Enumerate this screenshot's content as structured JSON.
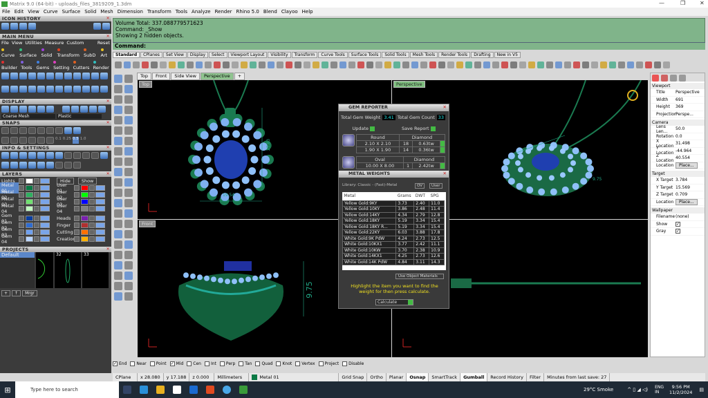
{
  "window": {
    "title": "Matrix 9.0 (64-bit) - uploads_files_3819209_1.3dm"
  },
  "menubar": [
    "File",
    "Edit",
    "View",
    "Curve",
    "Surface",
    "Solid",
    "Mesh",
    "Dimension",
    "Transform",
    "Tools",
    "Analyze",
    "Render",
    "Rhino 5.0",
    "Blend",
    "Clayoo",
    "Help"
  ],
  "left": {
    "icon_history": "ICON HISTORY",
    "main_menu": {
      "title": "MAIN MENU",
      "items": [
        "File",
        "View",
        "Utilities",
        "Measure",
        "Custom"
      ],
      "reset": "Reset",
      "row1": [
        {
          "l": "Curve",
          "c": "#e8c020"
        },
        {
          "l": "Surface",
          "c": "#30c080"
        },
        {
          "l": "Solid",
          "c": "#a040e0"
        },
        {
          "l": "Transform",
          "c": "#e04020"
        },
        {
          "l": "SubD",
          "c": "#e06020"
        },
        {
          "l": "Art",
          "c": "#e8c020"
        }
      ],
      "row2": [
        {
          "l": "Builder",
          "c": "#e03030"
        },
        {
          "l": "Tools",
          "c": "#8060e0"
        },
        {
          "l": "Gems",
          "c": "#4080e0"
        },
        {
          "l": "Setting",
          "c": "#e040c0"
        },
        {
          "l": "Cutters",
          "c": "#e06020"
        },
        {
          "l": "Render",
          "c": "#30c0c0"
        }
      ]
    },
    "display": {
      "title": "DISPLAY",
      "mesh": "Coarse Mesh",
      "material": "Plastic"
    },
    "snaps": {
      "title": "SNAPS",
      "values": [
        "0.1",
        "0.25",
        "0.5",
        "1.0"
      ]
    },
    "info": {
      "title": "INFO & SETTINGS"
    },
    "layers": {
      "title": "LAYERS",
      "lights": "Lights",
      "hide": "Hide",
      "show": "Show",
      "left": [
        {
          "n": "Metal 01",
          "c": "#0b7a45"
        },
        {
          "n": "Metal 02",
          "c": "#2fb060"
        },
        {
          "n": "Metal 03",
          "c": "#70e070"
        },
        {
          "n": "Metal 04",
          "c": "#c0f8c0"
        },
        {
          "n": "Gem 01",
          "c": "#0a3ea0"
        },
        {
          "n": "Gem 02",
          "c": "#2f6cd0"
        },
        {
          "n": "Gem 03",
          "c": "#6ea0f0"
        },
        {
          "n": "Gem 04",
          "c": "#b8d4ff"
        }
      ],
      "right": [
        {
          "n": "User 01",
          "c": "#ff0000"
        },
        {
          "n": "User 02",
          "c": "#00ff00"
        },
        {
          "n": "User 03",
          "c": "#0000ff"
        },
        {
          "n": "User 04",
          "c": "#808080"
        },
        {
          "n": "Heads",
          "c": "#7a20b0"
        },
        {
          "n": "Finger",
          "c": "#b03030"
        },
        {
          "n": "Cutting",
          "c": "#ff7000"
        },
        {
          "n": "Creation",
          "c": "#ffb000"
        }
      ]
    },
    "projects": {
      "title": "PROJECTS",
      "items": [
        "Default"
      ],
      "thumbs": [
        "32",
        "33"
      ],
      "merge": "Mrgr"
    }
  },
  "command": {
    "lines": [
      "Volume Total: 337.088779571623",
      "Command: _Show",
      "Showing 2 hidden objects."
    ],
    "prompt": "Command:"
  },
  "toolbar_tabs": [
    "Standard",
    "CPlanes",
    "Set View",
    "Display",
    "Select",
    "Viewport Layout",
    "Visibility",
    "Transform",
    "Curve Tools",
    "Surface Tools",
    "Solid Tools",
    "Mesh Tools",
    "Render Tools",
    "Drafting",
    "New in V5"
  ],
  "viewport_tabs": [
    "Top",
    "Front",
    "Side View",
    "Perspective",
    "+"
  ],
  "viewports": {
    "top": "Top",
    "front": "Front",
    "perspective": "Perspective",
    "dims": {
      "height": "27.83",
      "width": "19.54",
      "front_height": "9.75",
      "persp_a": "9.75",
      "persp_b": "19.54"
    }
  },
  "gem_reporter": {
    "title": "GEM REPORTER",
    "total_weight_label": "Total Gem Weight",
    "total_weight": "3.41",
    "total_count_label": "Total Gem Count",
    "total_count": "33",
    "update": "Update",
    "save": "Save Report",
    "groups": [
      {
        "shape": "Round",
        "material": "Diamond",
        "rows": [
          {
            "size": "2.10 X 2.10",
            "count": "18",
            "weight": "0.63tw"
          },
          {
            "size": "1.90 X 1.90",
            "count": "14",
            "weight": "0.36tw"
          }
        ]
      },
      {
        "shape": "Oval",
        "material": "Diamond",
        "rows": [
          {
            "size": "10.00 X 8.00",
            "count": "1",
            "weight": "2.42tw"
          }
        ]
      }
    ]
  },
  "metal_weights": {
    "title": "METAL WEIGHTS",
    "library": "Library: Classic - (Fast)-Metal",
    "ov": "OV",
    "user": "User",
    "columns": [
      "Metal",
      "Grams",
      "DWT",
      "SPG"
    ],
    "rows": [
      [
        "Yellow Gold:9KY",
        "3.73",
        "2.40",
        "11.0"
      ],
      [
        "Yellow Gold:10KY",
        "3.86",
        "2.48",
        "11.4"
      ],
      [
        "Yellow Gold:14KY",
        "4.34",
        "2.79",
        "12.8"
      ],
      [
        "Yellow Gold:18KY",
        "5.19",
        "3.34",
        "15.4"
      ],
      [
        "Yellow Gold:18KY R...",
        "5.19",
        "3.34",
        "15.4"
      ],
      [
        "Yellow Gold:22KY",
        "6.03",
        "3.88",
        "17.8"
      ],
      [
        "White Gold:9K PdW",
        "4.24",
        "2.73",
        "12.5"
      ],
      [
        "White Gold:10KX1",
        "3.77",
        "2.42",
        "11.1"
      ],
      [
        "White Gold:10KW",
        "3.70",
        "2.38",
        "10.9"
      ],
      [
        "White Gold:14KX1",
        "4.25",
        "2.73",
        "12.6"
      ],
      [
        "White Gold:14K PdW",
        "4.84",
        "3.11",
        "14.3"
      ]
    ],
    "use_object": "Use Object Materials",
    "hint": "Highlight the item you want to find the weight for then press calculate.",
    "calculate": "Calculate"
  },
  "properties": {
    "viewport": {
      "title": "Viewport",
      "rows": [
        [
          "Title",
          "Perspective"
        ],
        [
          "Width",
          "691"
        ],
        [
          "Height",
          "369"
        ],
        [
          "Projection",
          "Perspe..."
        ]
      ]
    },
    "camera": {
      "title": "Camera",
      "rows": [
        [
          "Lens Len...",
          "50.0"
        ],
        [
          "Rotation",
          "0.0"
        ],
        [
          "X Location",
          "31.498"
        ],
        [
          "Y Location",
          "-44.964"
        ],
        [
          "Z Location",
          "40.554"
        ]
      ],
      "location": "Location",
      "place": "Place..."
    },
    "target": {
      "title": "Target",
      "rows": [
        [
          "X Target",
          "3.784"
        ],
        [
          "Y Target",
          "15.569"
        ],
        [
          "Z Target",
          "0.709"
        ]
      ],
      "location": "Location",
      "place": "Place..."
    },
    "wallpaper": {
      "title": "Wallpaper",
      "filename_label": "Filename",
      "filename": "(none)",
      "show": "Show",
      "gray": "Gray"
    }
  },
  "osnap": [
    {
      "l": "End",
      "c": true
    },
    {
      "l": "Near",
      "c": false
    },
    {
      "l": "Point",
      "c": false
    },
    {
      "l": "Mid",
      "c": true
    },
    {
      "l": "Cen",
      "c": false
    },
    {
      "l": "Int",
      "c": false
    },
    {
      "l": "Perp",
      "c": false
    },
    {
      "l": "Tan",
      "c": false
    },
    {
      "l": "Quad",
      "c": false
    },
    {
      "l": "Knot",
      "c": false
    },
    {
      "l": "Vertex",
      "c": false
    },
    {
      "l": "Project",
      "c": false
    },
    {
      "l": "Disable",
      "c": false
    }
  ],
  "status": {
    "cplane": "CPlane",
    "x": "x 28.080",
    "y": "y 17.188",
    "z": "z 0.000",
    "units": "Millimeters",
    "layer": "Metal 01",
    "layer_color": "#0b7a45",
    "toggles": [
      "Grid Snap",
      "Ortho",
      "Planar",
      "Osnap",
      "SmartTrack",
      "Gumball",
      "Record History",
      "Filter"
    ],
    "minutes": "Minutes from last save: 27"
  },
  "taskbar": {
    "search": "Type here to search",
    "weather": "29°C  Smoke",
    "lang1": "ENG",
    "lang2": "IN",
    "time": "9:56 PM",
    "date": "11/2/2024"
  }
}
